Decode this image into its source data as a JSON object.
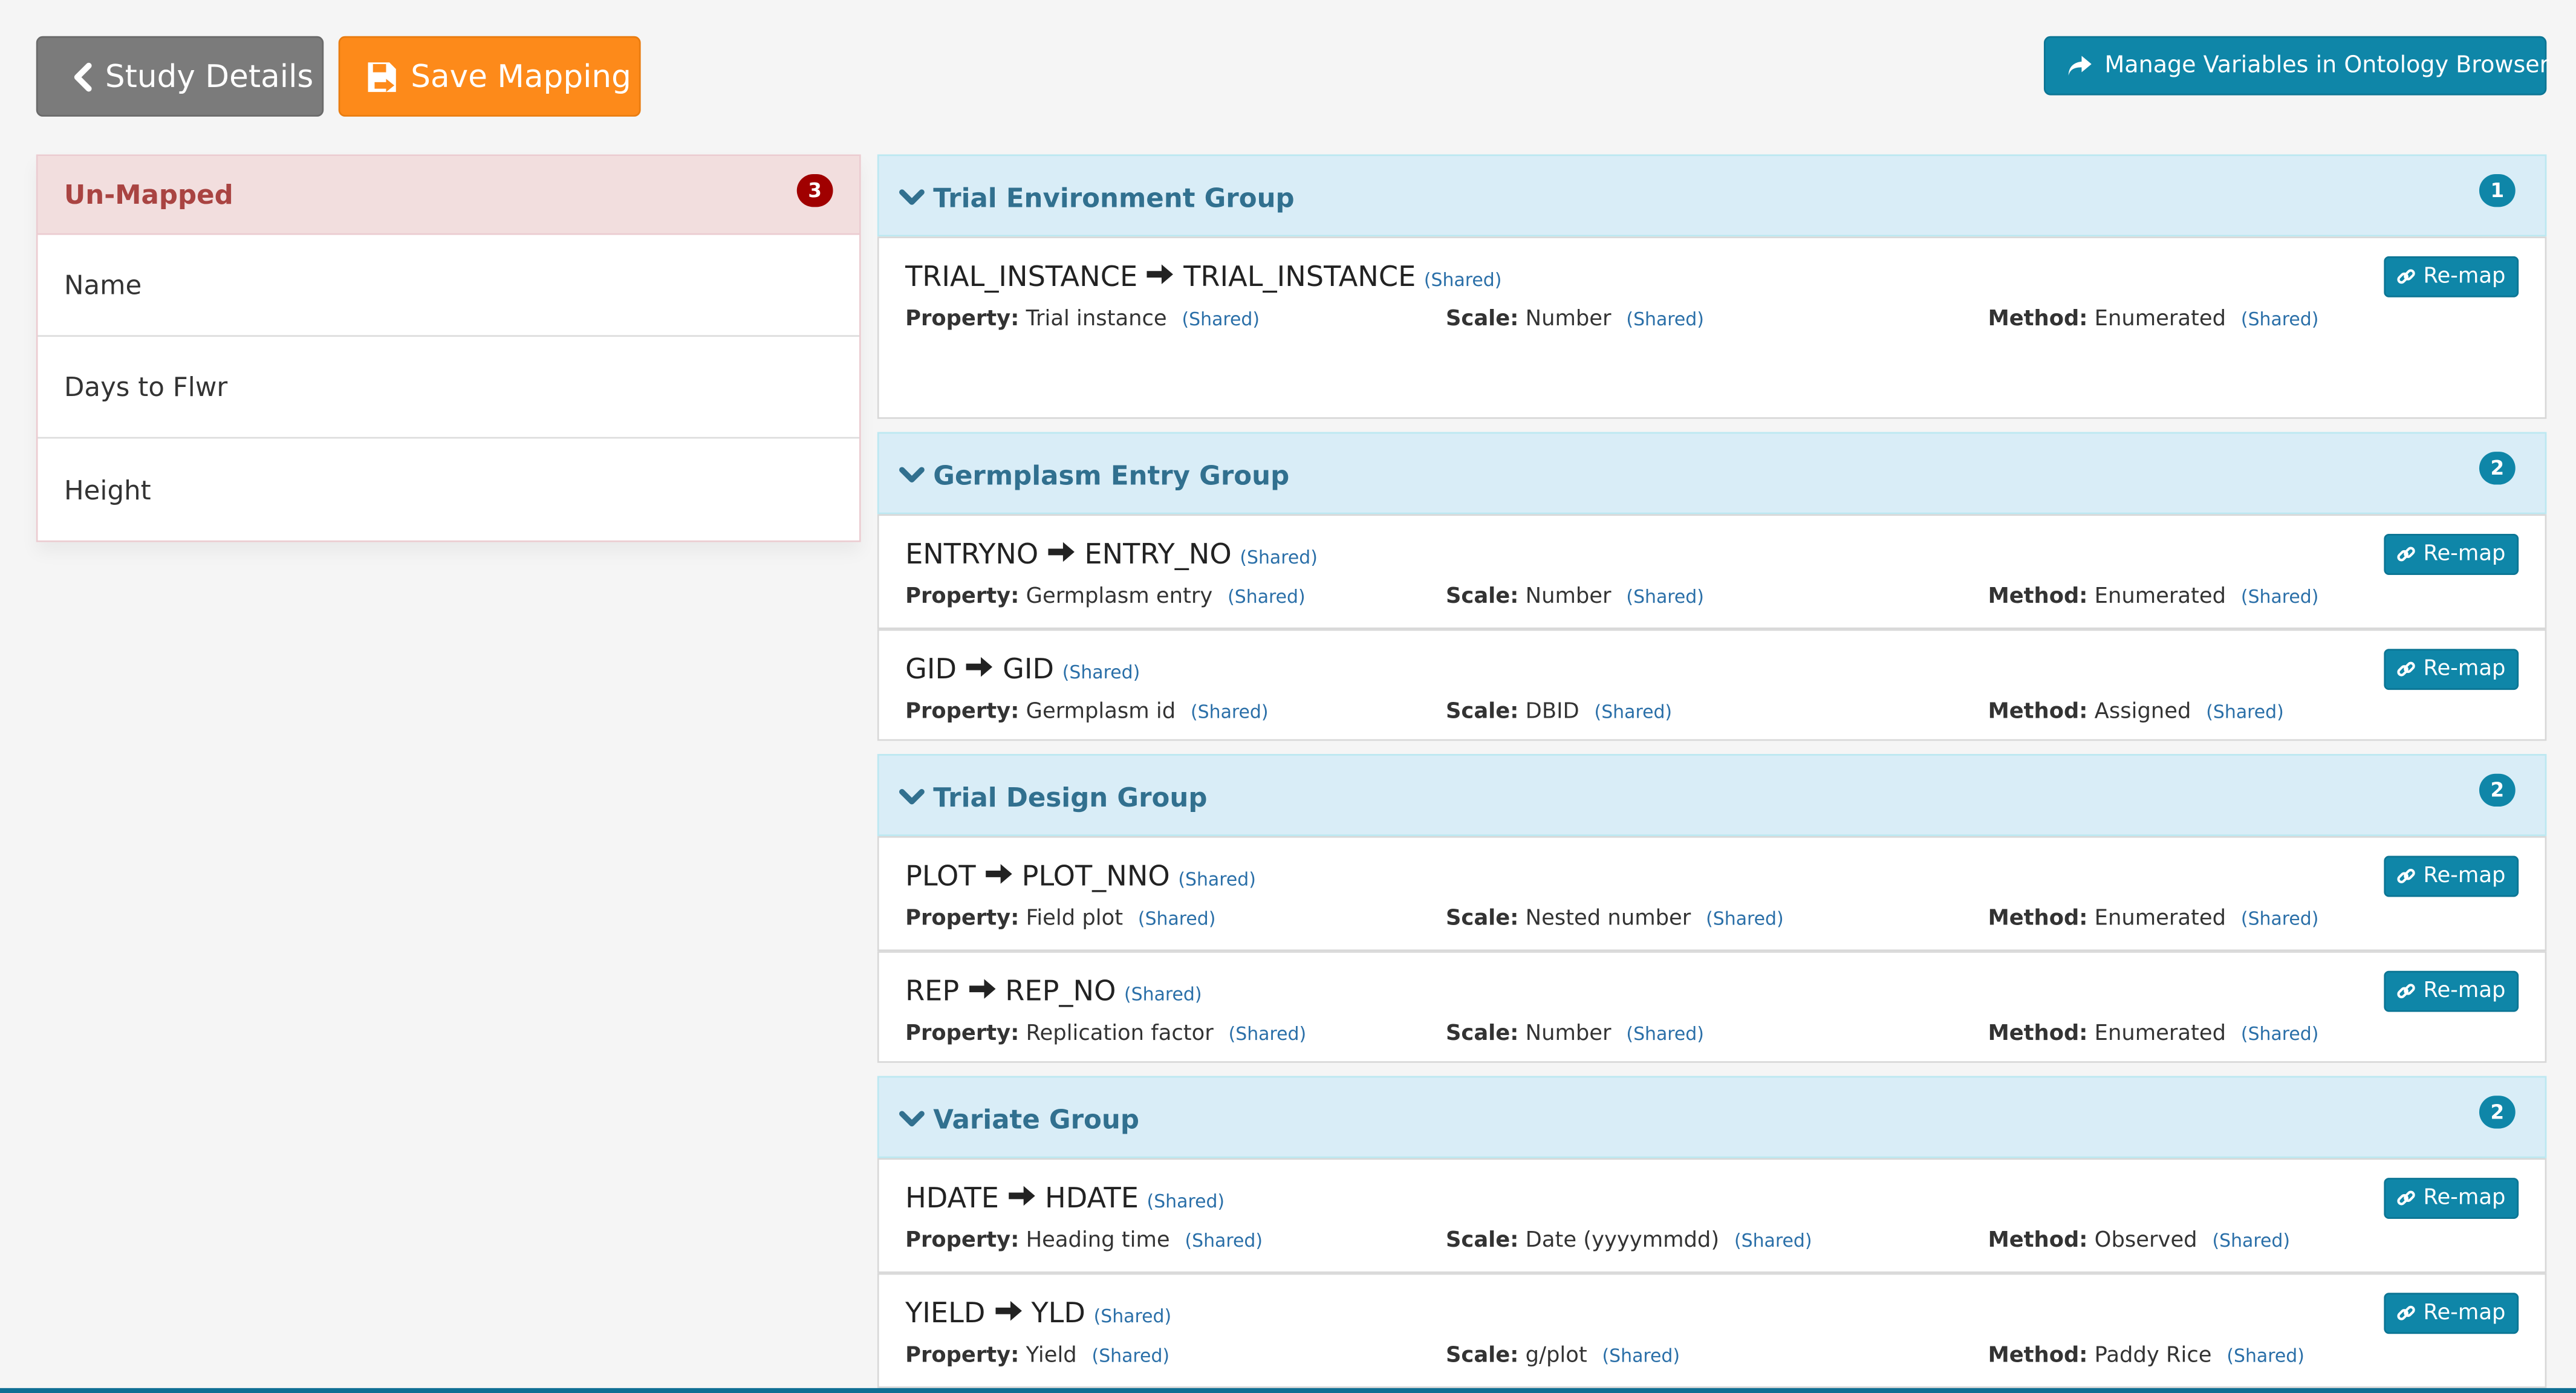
{
  "toolbar": {
    "study_details_label": "Study Details",
    "save_mapping_label": "Save Mapping",
    "manage_variables_label": "Manage Variables in Ontology Browser"
  },
  "unmapped": {
    "title": "Un-Mapped",
    "count": "3",
    "items": [
      "Name",
      "Days to Flwr",
      "Height"
    ]
  },
  "labels": {
    "property": "Property:",
    "scale": "Scale:",
    "method": "Method:",
    "shared": "(Shared)",
    "remap": "Re-map"
  },
  "groups": [
    {
      "title": "Trial Environment Group",
      "count": "1",
      "items": [
        {
          "source": "TRIAL_INSTANCE",
          "target": "TRIAL_INSTANCE",
          "property": "Trial instance",
          "scale": "Number",
          "method": "Enumerated"
        }
      ]
    },
    {
      "title": "Germplasm Entry Group",
      "count": "2",
      "items": [
        {
          "source": "ENTRYNO",
          "target": "ENTRY_NO",
          "property": "Germplasm entry",
          "scale": "Number",
          "method": "Enumerated"
        },
        {
          "source": "GID",
          "target": "GID",
          "property": "Germplasm id",
          "scale": "DBID",
          "method": "Assigned"
        }
      ]
    },
    {
      "title": "Trial Design Group",
      "count": "2",
      "items": [
        {
          "source": "PLOT",
          "target": "PLOT_NNO",
          "property": "Field plot",
          "scale": "Nested number",
          "method": "Enumerated"
        },
        {
          "source": "REP",
          "target": "REP_NO",
          "property": "Replication factor",
          "scale": "Number",
          "method": "Enumerated"
        }
      ]
    },
    {
      "title": "Variate Group",
      "count": "2",
      "items": [
        {
          "source": "HDATE",
          "target": "HDATE",
          "property": "Heading time",
          "scale": "Date (yyyymmdd)",
          "method": "Observed"
        },
        {
          "source": "YIELD",
          "target": "YLD",
          "property": "Yield",
          "scale": "g/plot",
          "method": "Paddy Rice"
        }
      ]
    }
  ],
  "icons": {
    "back": "chevron-left-icon",
    "save": "save-icon",
    "share": "share-arrow-icon",
    "collapse": "chevron-down-icon",
    "link": "link-icon",
    "map_arrow": "arrow-right-icon"
  },
  "colors": {
    "save_button": "#fd8a1a",
    "study_button": "#7b7b7b",
    "primary_button": "#0f86a8",
    "danger_badge": "#a00000",
    "danger_heading_bg": "#f2dede",
    "info_heading_bg": "#d9edf7"
  }
}
